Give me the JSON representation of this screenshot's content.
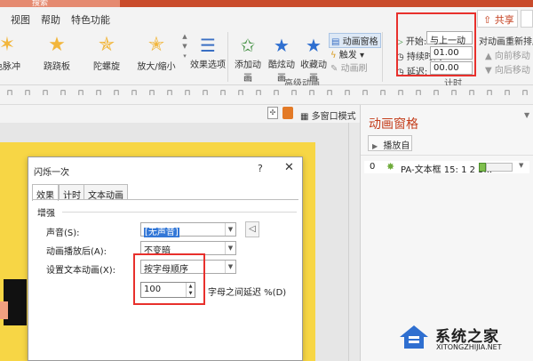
{
  "titlebar": {
    "search_placeholder": "搜索"
  },
  "menu": {
    "items": [
      "视图",
      "帮助",
      "特色功能"
    ],
    "share_label": "共享"
  },
  "ribbon": {
    "animations": [
      "色脉冲",
      "跷跷板",
      "陀螺旋",
      "放大/缩小"
    ],
    "effect_options_label": "效果选项",
    "add_animation_label": "添加动画",
    "painter_label": "酷炫动画",
    "collect_label": "收藏动画",
    "anim_pane_label": "动画窗格",
    "trigger_label": "触发",
    "anim_brush_label": "动画刷",
    "advanced_group_label": "高级动画",
    "timing": {
      "start_label": "开始:",
      "start_value": "与上一动画...",
      "duration_label": "持续时间:",
      "duration_value": "01.00",
      "delay_label": "延迟:",
      "delay_value": "00.00"
    },
    "reorder_label": "对动画重新排序",
    "move_earlier_label": "向前移动",
    "move_later_label": "向后移动",
    "timing_group_label": "计时"
  },
  "toolbar3": {
    "multiwindow_label": "多窗口模式"
  },
  "dialog": {
    "title": "闪烁一次",
    "help": "?",
    "tabs": [
      "效果",
      "计时",
      "文本动画"
    ],
    "section": "增强",
    "sound_label": "声音(S):",
    "sound_value": "[无声音]",
    "after_anim_label": "动画播放后(A):",
    "after_anim_value": "不变暗",
    "text_anim_label": "设置文本动画(X):",
    "text_anim_value": "按字母顺序",
    "delay_value": "100",
    "delay_suffix": "字母之间延迟 %(D)"
  },
  "pane": {
    "title": "动画窗格",
    "play_label": "播放自",
    "rows": [
      {
        "num": "0",
        "text": "PA-文本框 15: 1 2 3..."
      }
    ]
  },
  "watermark": {
    "title": "系统之家",
    "url": "XITONGZHIJIA.NET"
  },
  "colors": {
    "accent": "#c43e1c",
    "highlight_box": "#e8302c",
    "slide": "#f7d645"
  }
}
